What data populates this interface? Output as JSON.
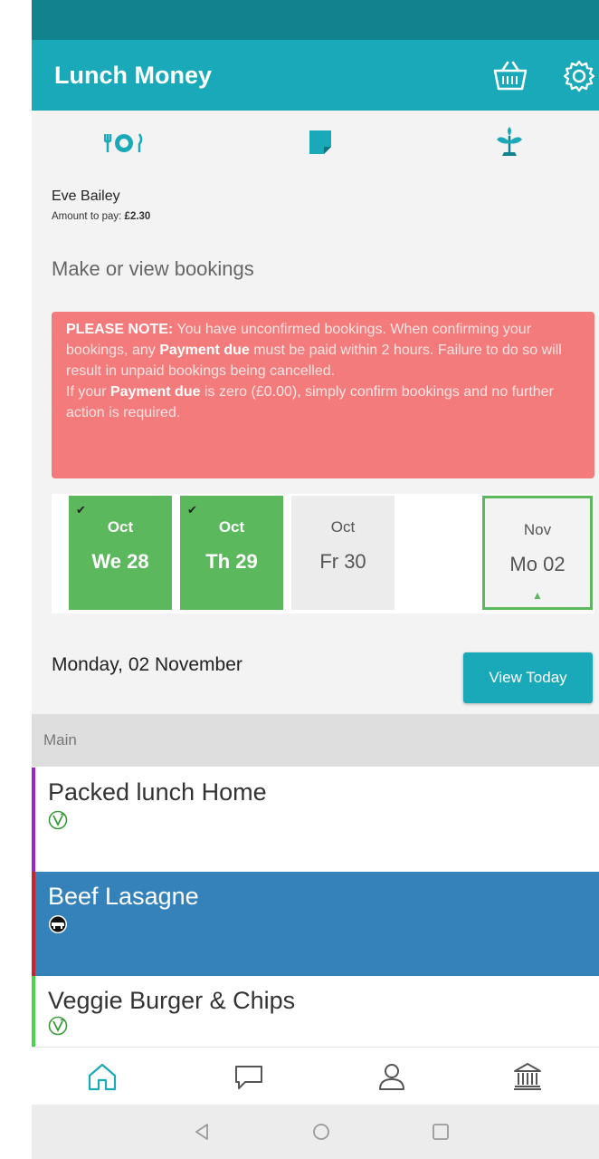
{
  "app": {
    "title": "Lunch Money",
    "icons": [
      "basket-icon",
      "gear-icon"
    ]
  },
  "top_tabs": [
    {
      "name": "meals",
      "icon": "plate-cutlery-icon"
    },
    {
      "name": "notes",
      "icon": "sticky-note-icon"
    },
    {
      "name": "nutrition",
      "icon": "plant-icon"
    }
  ],
  "student": {
    "name": "Eve Bailey",
    "amount_label": "Amount to pay: ",
    "amount_value": "£2.30"
  },
  "section_heading": "Make or view bookings",
  "notice": {
    "lead": "PLEASE NOTE:",
    "part1": " You have unconfirmed bookings. When confirming your bookings, any ",
    "payment_due_1": "Payment due",
    "part2": " must be paid within 2 hours. Failure to do so will result in unpaid bookings being cancelled.",
    "part3": "If your ",
    "payment_due_2": "Payment due",
    "part4": " is zero (£0.00), simply confirm bookings and no further action is required."
  },
  "days": [
    {
      "month": "Oct",
      "day": "We 28",
      "state": "booked",
      "check": "✔"
    },
    {
      "month": "Oct",
      "day": "Th 29",
      "state": "booked",
      "check": "✔"
    },
    {
      "month": "Oct",
      "day": "Fr 30",
      "state": "plain"
    },
    {
      "month": "Nov",
      "day": "Mo 02",
      "state": "selected"
    }
  ],
  "selected_date": "Monday, 02 November",
  "view_today_label": "View Today",
  "group_label": "Main",
  "meals": [
    {
      "name": "Packed lunch Home",
      "diet_icon": "vegetarian-icon",
      "accent": "#9b22cc"
    },
    {
      "name": "Beef Lasagne",
      "diet_icon": "beef-icon",
      "accent": "#c4262e",
      "selected": true
    },
    {
      "name": "Veggie Burger & Chips",
      "diet_icon": "vegetarian-icon",
      "accent": "#4cd34c"
    }
  ],
  "bottom_nav": [
    "home-icon",
    "chat-icon",
    "profile-icon",
    "bank-icon"
  ],
  "system_nav": [
    "back-icon",
    "home-circle-icon",
    "recents-icon"
  ],
  "colors": {
    "primary": "#1aa9b8",
    "status_bar": "#12828f",
    "booked": "#5cb85c",
    "notice": "#f47b7b",
    "selected_row": "#3581ba"
  }
}
